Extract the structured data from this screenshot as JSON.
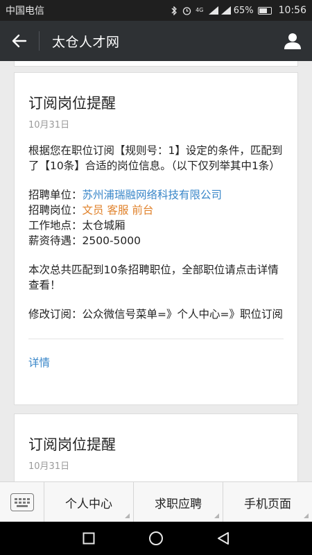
{
  "status_bar": {
    "carrier": "中国电信",
    "battery": "65%",
    "time": "10:56",
    "network": "4G"
  },
  "header": {
    "title": "太仓人才网"
  },
  "cards": [
    {
      "title": "订阅岗位提醒",
      "date": "10月31日",
      "intro": "根据您在职位订阅【规则号：1】设定的条件，匹配到了【10条】合适的岗位信息。（以下仅列举其中1条）",
      "company_label": "招聘单位：",
      "company": "苏州浦瑞融网络科技有限公司",
      "position_label": "招聘岗位：",
      "position": "文员 客服 前台",
      "location_label": "工作地点：",
      "location": "太仓城厢",
      "salary_label": "薪资待遇：",
      "salary": "2500-5000",
      "summary": "本次总共匹配到10条招聘职位，全部职位请点击详情查看！",
      "modify": "修改订阅：公众微信号菜单=》个人中心=》职位订阅",
      "detail_link": "详情"
    },
    {
      "title": "订阅岗位提醒",
      "date": "10月31日"
    }
  ],
  "bottom_menu": {
    "items": [
      "个人中心",
      "求职应聘",
      "手机页面"
    ]
  },
  "icons": {
    "back": "arrow-left-icon",
    "user": "user-icon",
    "keyboard": "keyboard-icon"
  },
  "colors": {
    "header_bg": "#2e3134",
    "link": "#3a87c9",
    "highlight": "#e0812a"
  }
}
